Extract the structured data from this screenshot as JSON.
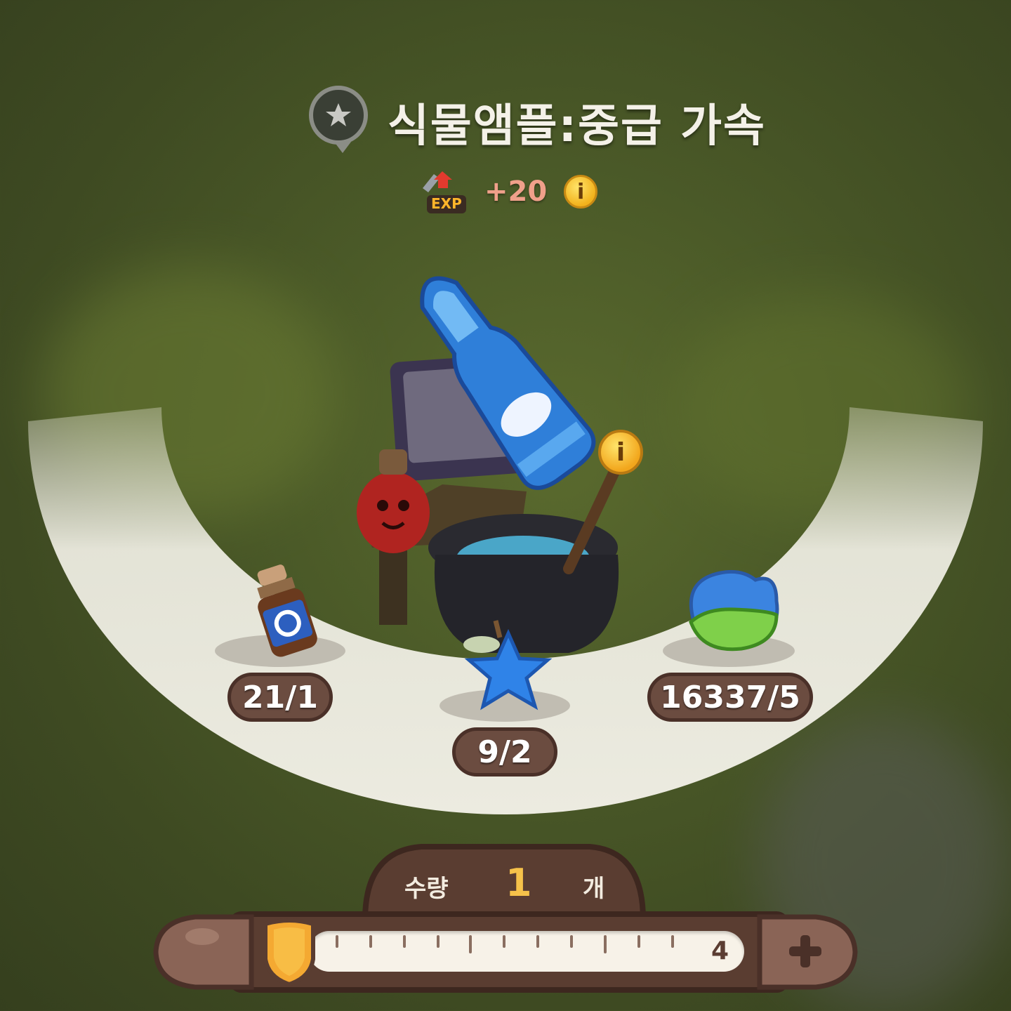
{
  "recipe": {
    "title": "식물앰플:중급 가속",
    "exp_gain": "+20",
    "exp_icon_label": "EXP"
  },
  "ingredients": [
    {
      "name": "gear-potion-bottle",
      "count": "21/1"
    },
    {
      "name": "blue-star-fruit",
      "count": "9/2"
    },
    {
      "name": "blue-green-jelly-leaf",
      "count": "16337/5"
    }
  ],
  "quantity": {
    "label": "수량",
    "value": "1",
    "unit": "개",
    "max": "4",
    "min": 1,
    "slider_max": 4
  },
  "icons": {
    "badge": "star-icon",
    "info": "info-icon",
    "minus": "minus-icon",
    "plus": "plus-icon"
  },
  "colors": {
    "accent_gold": "#f6c24a",
    "badge_brown": "#6b4c40",
    "exp_pink": "#f0a08a"
  }
}
